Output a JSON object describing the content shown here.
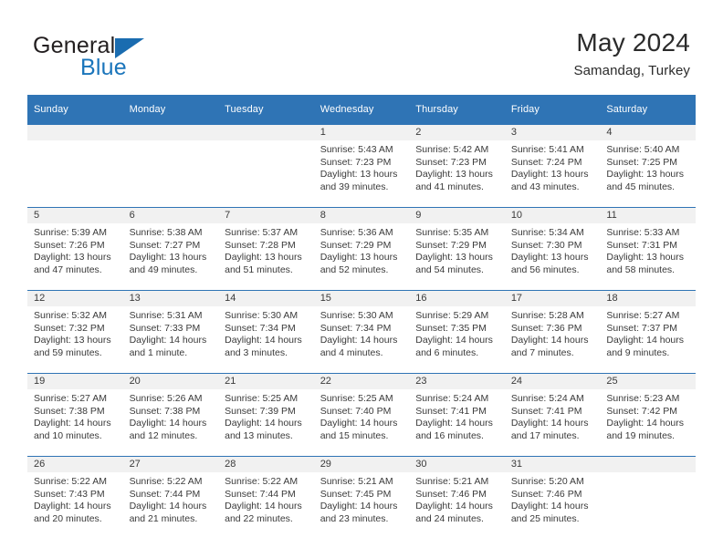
{
  "brand": {
    "name_part1": "General",
    "name_part2": "Blue",
    "flag_icon": "triangle-flag-icon"
  },
  "header": {
    "title": "May 2024",
    "subtitle": "Samandag, Turkey"
  },
  "calendar": {
    "weekday_headers": [
      "Sunday",
      "Monday",
      "Tuesday",
      "Wednesday",
      "Thursday",
      "Friday",
      "Saturday"
    ],
    "header_bg": "#2f74b5",
    "daynum_bg": "#f1f1f1",
    "weeks": [
      [
        {
          "day": "",
          "empty": true,
          "sunrise": "",
          "sunset": "",
          "daylight_line1": "",
          "daylight_line2": ""
        },
        {
          "day": "",
          "empty": true,
          "sunrise": "",
          "sunset": "",
          "daylight_line1": "",
          "daylight_line2": ""
        },
        {
          "day": "",
          "empty": true,
          "sunrise": "",
          "sunset": "",
          "daylight_line1": "",
          "daylight_line2": ""
        },
        {
          "day": "1",
          "empty": false,
          "sunrise": "Sunrise: 5:43 AM",
          "sunset": "Sunset: 7:23 PM",
          "daylight_line1": "Daylight: 13 hours",
          "daylight_line2": "and 39 minutes."
        },
        {
          "day": "2",
          "empty": false,
          "sunrise": "Sunrise: 5:42 AM",
          "sunset": "Sunset: 7:23 PM",
          "daylight_line1": "Daylight: 13 hours",
          "daylight_line2": "and 41 minutes."
        },
        {
          "day": "3",
          "empty": false,
          "sunrise": "Sunrise: 5:41 AM",
          "sunset": "Sunset: 7:24 PM",
          "daylight_line1": "Daylight: 13 hours",
          "daylight_line2": "and 43 minutes."
        },
        {
          "day": "4",
          "empty": false,
          "sunrise": "Sunrise: 5:40 AM",
          "sunset": "Sunset: 7:25 PM",
          "daylight_line1": "Daylight: 13 hours",
          "daylight_line2": "and 45 minutes."
        }
      ],
      [
        {
          "day": "5",
          "empty": false,
          "sunrise": "Sunrise: 5:39 AM",
          "sunset": "Sunset: 7:26 PM",
          "daylight_line1": "Daylight: 13 hours",
          "daylight_line2": "and 47 minutes."
        },
        {
          "day": "6",
          "empty": false,
          "sunrise": "Sunrise: 5:38 AM",
          "sunset": "Sunset: 7:27 PM",
          "daylight_line1": "Daylight: 13 hours",
          "daylight_line2": "and 49 minutes."
        },
        {
          "day": "7",
          "empty": false,
          "sunrise": "Sunrise: 5:37 AM",
          "sunset": "Sunset: 7:28 PM",
          "daylight_line1": "Daylight: 13 hours",
          "daylight_line2": "and 51 minutes."
        },
        {
          "day": "8",
          "empty": false,
          "sunrise": "Sunrise: 5:36 AM",
          "sunset": "Sunset: 7:29 PM",
          "daylight_line1": "Daylight: 13 hours",
          "daylight_line2": "and 52 minutes."
        },
        {
          "day": "9",
          "empty": false,
          "sunrise": "Sunrise: 5:35 AM",
          "sunset": "Sunset: 7:29 PM",
          "daylight_line1": "Daylight: 13 hours",
          "daylight_line2": "and 54 minutes."
        },
        {
          "day": "10",
          "empty": false,
          "sunrise": "Sunrise: 5:34 AM",
          "sunset": "Sunset: 7:30 PM",
          "daylight_line1": "Daylight: 13 hours",
          "daylight_line2": "and 56 minutes."
        },
        {
          "day": "11",
          "empty": false,
          "sunrise": "Sunrise: 5:33 AM",
          "sunset": "Sunset: 7:31 PM",
          "daylight_line1": "Daylight: 13 hours",
          "daylight_line2": "and 58 minutes."
        }
      ],
      [
        {
          "day": "12",
          "empty": false,
          "sunrise": "Sunrise: 5:32 AM",
          "sunset": "Sunset: 7:32 PM",
          "daylight_line1": "Daylight: 13 hours",
          "daylight_line2": "and 59 minutes."
        },
        {
          "day": "13",
          "empty": false,
          "sunrise": "Sunrise: 5:31 AM",
          "sunset": "Sunset: 7:33 PM",
          "daylight_line1": "Daylight: 14 hours",
          "daylight_line2": "and 1 minute."
        },
        {
          "day": "14",
          "empty": false,
          "sunrise": "Sunrise: 5:30 AM",
          "sunset": "Sunset: 7:34 PM",
          "daylight_line1": "Daylight: 14 hours",
          "daylight_line2": "and 3 minutes."
        },
        {
          "day": "15",
          "empty": false,
          "sunrise": "Sunrise: 5:30 AM",
          "sunset": "Sunset: 7:34 PM",
          "daylight_line1": "Daylight: 14 hours",
          "daylight_line2": "and 4 minutes."
        },
        {
          "day": "16",
          "empty": false,
          "sunrise": "Sunrise: 5:29 AM",
          "sunset": "Sunset: 7:35 PM",
          "daylight_line1": "Daylight: 14 hours",
          "daylight_line2": "and 6 minutes."
        },
        {
          "day": "17",
          "empty": false,
          "sunrise": "Sunrise: 5:28 AM",
          "sunset": "Sunset: 7:36 PM",
          "daylight_line1": "Daylight: 14 hours",
          "daylight_line2": "and 7 minutes."
        },
        {
          "day": "18",
          "empty": false,
          "sunrise": "Sunrise: 5:27 AM",
          "sunset": "Sunset: 7:37 PM",
          "daylight_line1": "Daylight: 14 hours",
          "daylight_line2": "and 9 minutes."
        }
      ],
      [
        {
          "day": "19",
          "empty": false,
          "sunrise": "Sunrise: 5:27 AM",
          "sunset": "Sunset: 7:38 PM",
          "daylight_line1": "Daylight: 14 hours",
          "daylight_line2": "and 10 minutes."
        },
        {
          "day": "20",
          "empty": false,
          "sunrise": "Sunrise: 5:26 AM",
          "sunset": "Sunset: 7:38 PM",
          "daylight_line1": "Daylight: 14 hours",
          "daylight_line2": "and 12 minutes."
        },
        {
          "day": "21",
          "empty": false,
          "sunrise": "Sunrise: 5:25 AM",
          "sunset": "Sunset: 7:39 PM",
          "daylight_line1": "Daylight: 14 hours",
          "daylight_line2": "and 13 minutes."
        },
        {
          "day": "22",
          "empty": false,
          "sunrise": "Sunrise: 5:25 AM",
          "sunset": "Sunset: 7:40 PM",
          "daylight_line1": "Daylight: 14 hours",
          "daylight_line2": "and 15 minutes."
        },
        {
          "day": "23",
          "empty": false,
          "sunrise": "Sunrise: 5:24 AM",
          "sunset": "Sunset: 7:41 PM",
          "daylight_line1": "Daylight: 14 hours",
          "daylight_line2": "and 16 minutes."
        },
        {
          "day": "24",
          "empty": false,
          "sunrise": "Sunrise: 5:24 AM",
          "sunset": "Sunset: 7:41 PM",
          "daylight_line1": "Daylight: 14 hours",
          "daylight_line2": "and 17 minutes."
        },
        {
          "day": "25",
          "empty": false,
          "sunrise": "Sunrise: 5:23 AM",
          "sunset": "Sunset: 7:42 PM",
          "daylight_line1": "Daylight: 14 hours",
          "daylight_line2": "and 19 minutes."
        }
      ],
      [
        {
          "day": "26",
          "empty": false,
          "sunrise": "Sunrise: 5:22 AM",
          "sunset": "Sunset: 7:43 PM",
          "daylight_line1": "Daylight: 14 hours",
          "daylight_line2": "and 20 minutes."
        },
        {
          "day": "27",
          "empty": false,
          "sunrise": "Sunrise: 5:22 AM",
          "sunset": "Sunset: 7:44 PM",
          "daylight_line1": "Daylight: 14 hours",
          "daylight_line2": "and 21 minutes."
        },
        {
          "day": "28",
          "empty": false,
          "sunrise": "Sunrise: 5:22 AM",
          "sunset": "Sunset: 7:44 PM",
          "daylight_line1": "Daylight: 14 hours",
          "daylight_line2": "and 22 minutes."
        },
        {
          "day": "29",
          "empty": false,
          "sunrise": "Sunrise: 5:21 AM",
          "sunset": "Sunset: 7:45 PM",
          "daylight_line1": "Daylight: 14 hours",
          "daylight_line2": "and 23 minutes."
        },
        {
          "day": "30",
          "empty": false,
          "sunrise": "Sunrise: 5:21 AM",
          "sunset": "Sunset: 7:46 PM",
          "daylight_line1": "Daylight: 14 hours",
          "daylight_line2": "and 24 minutes."
        },
        {
          "day": "31",
          "empty": false,
          "sunrise": "Sunrise: 5:20 AM",
          "sunset": "Sunset: 7:46 PM",
          "daylight_line1": "Daylight: 14 hours",
          "daylight_line2": "and 25 minutes."
        },
        {
          "day": "",
          "empty": true,
          "sunrise": "",
          "sunset": "",
          "daylight_line1": "",
          "daylight_line2": ""
        }
      ]
    ]
  }
}
